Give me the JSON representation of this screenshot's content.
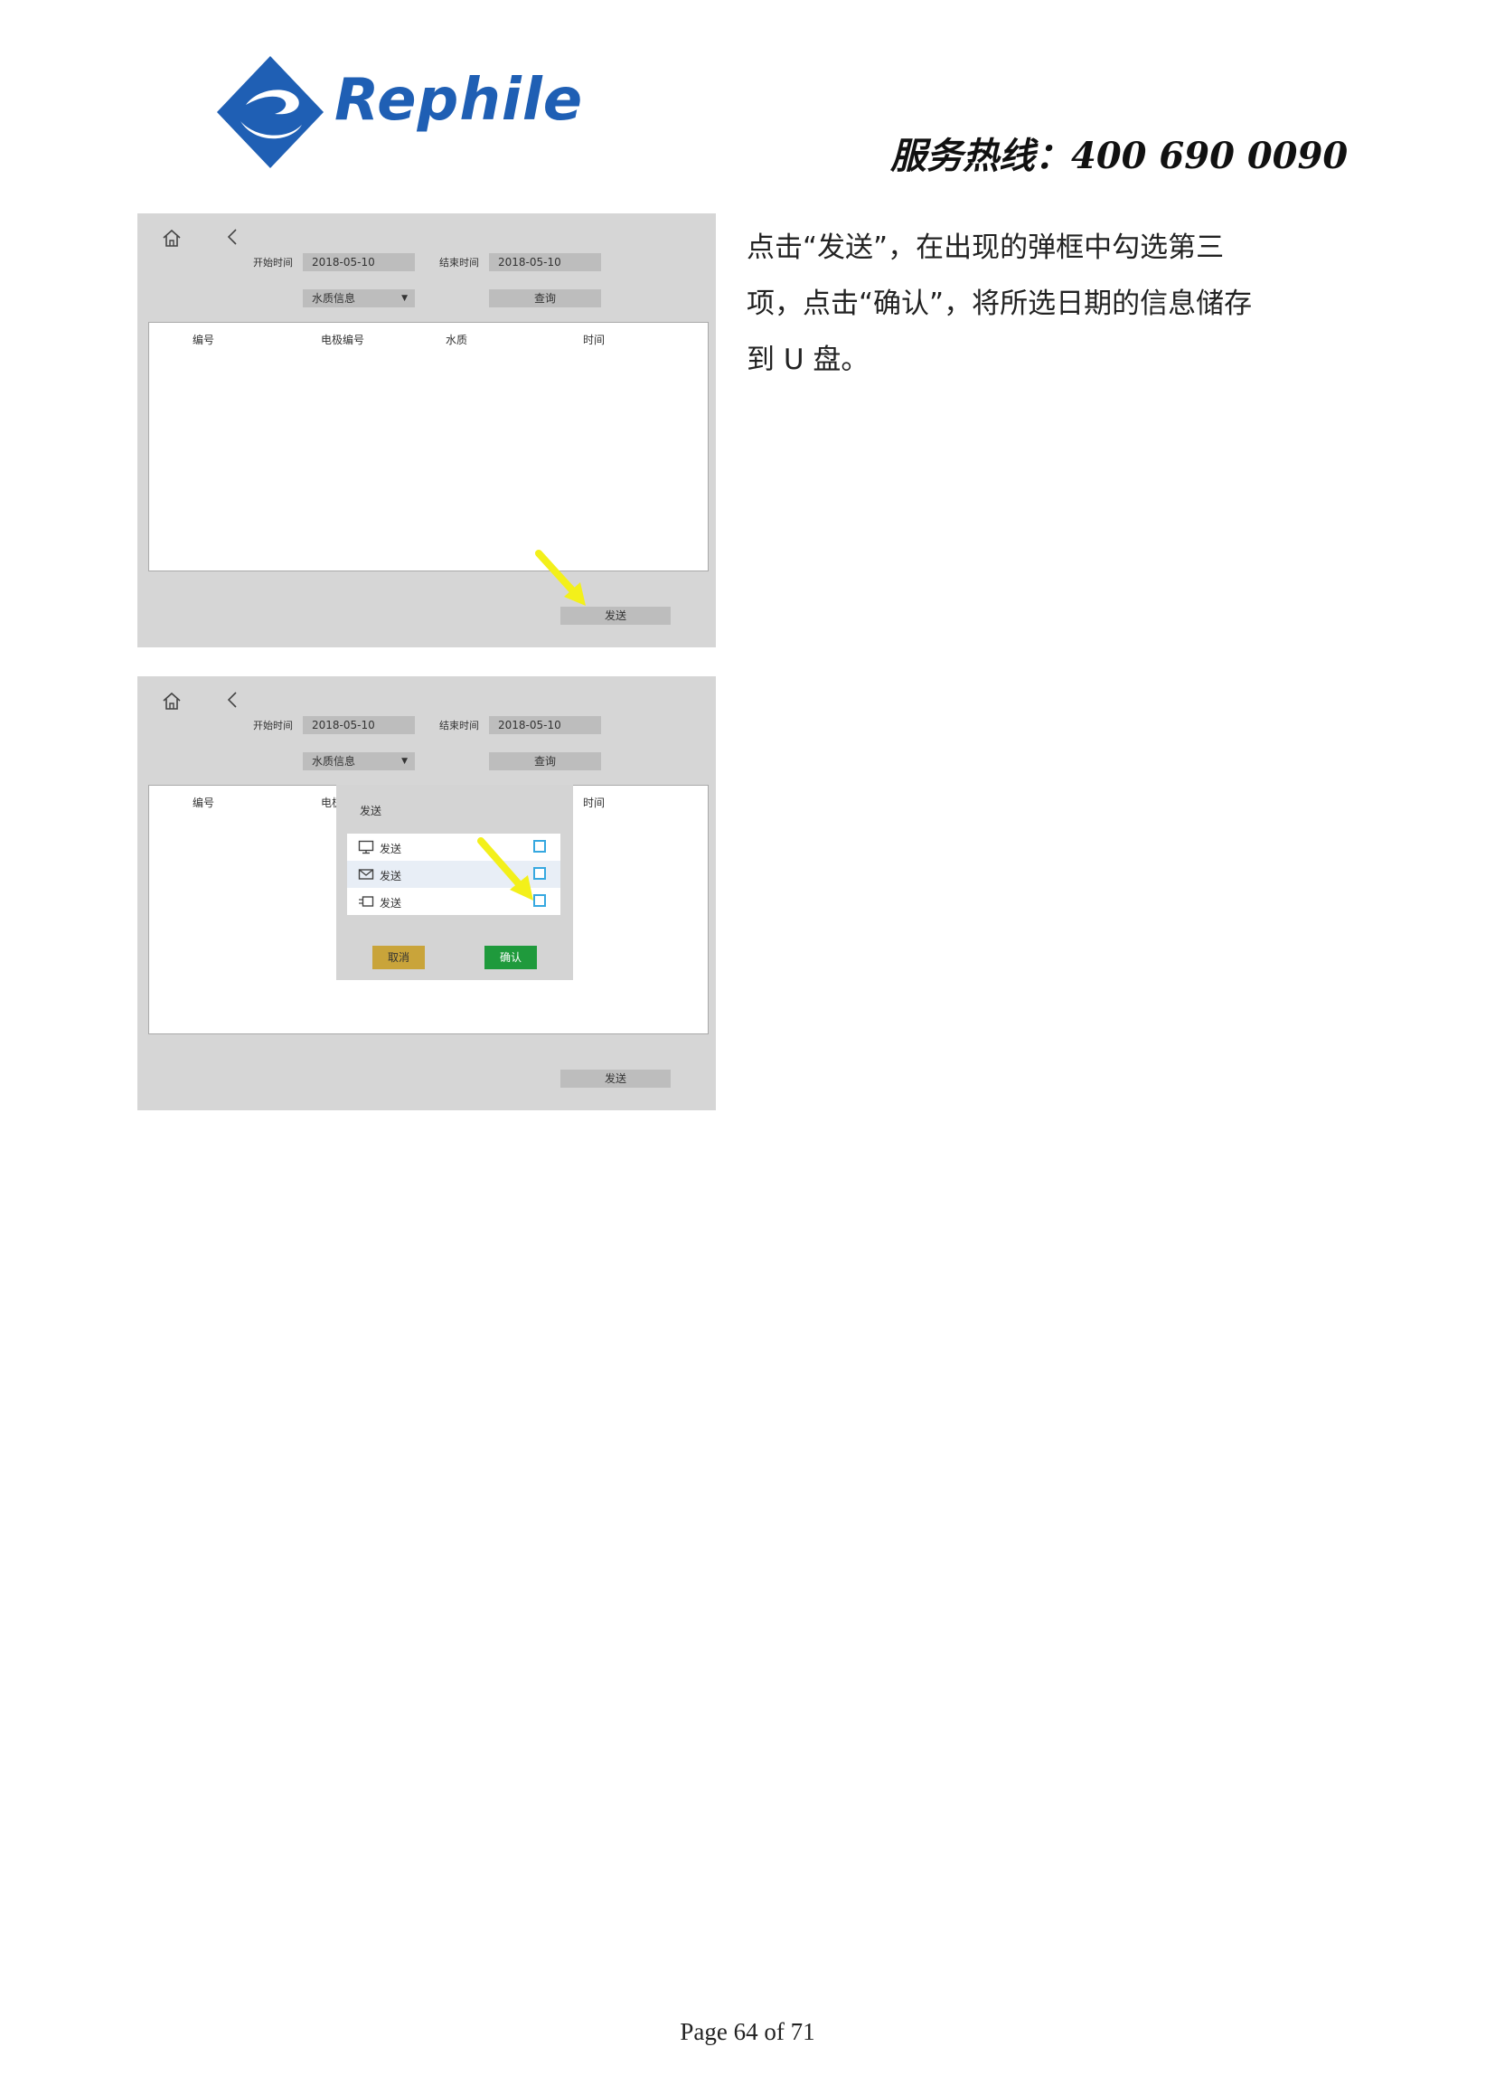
{
  "header": {
    "logo_text": "Rephile",
    "hotline": "服务热线：400  690  0090"
  },
  "screens": [
    {
      "start_label": "开始时间",
      "start_value": "2018-05-10",
      "end_label": "结束时间",
      "end_value": "2018-05-10",
      "dropdown_value": "水质信息",
      "query_label": "查询",
      "columns": [
        "编号",
        "电极编号",
        "水质",
        "时间"
      ],
      "send_label": "发送"
    },
    {
      "start_label": "开始时间",
      "start_value": "2018-05-10",
      "end_label": "结束时间",
      "end_value": "2018-05-10",
      "dropdown_value": "水质信息",
      "query_label": "查询",
      "columns": [
        "编号",
        "电极",
        "时间"
      ],
      "send_label": "发送",
      "dialog": {
        "title": "发送",
        "options": [
          {
            "label": "发送",
            "icon": "monitor-icon"
          },
          {
            "label": "发送",
            "icon": "mail-icon"
          },
          {
            "label": "发送",
            "icon": "usb-icon"
          }
        ],
        "cancel_label": "取消",
        "confirm_label": "确认"
      }
    }
  ],
  "body_text": "点击“发送”，在出现的弹框中勾选第三项，点击“确认”，将所选日期的信息储存到 U 盘。",
  "footer": "Page 64 of 71",
  "colors": {
    "brand_blue": "#1f5fb4",
    "arrow_yellow": "#f3f01a",
    "cancel_gold": "#c9a43a",
    "confirm_green": "#1f9a3c",
    "checkbox_blue": "#36a8e0"
  }
}
